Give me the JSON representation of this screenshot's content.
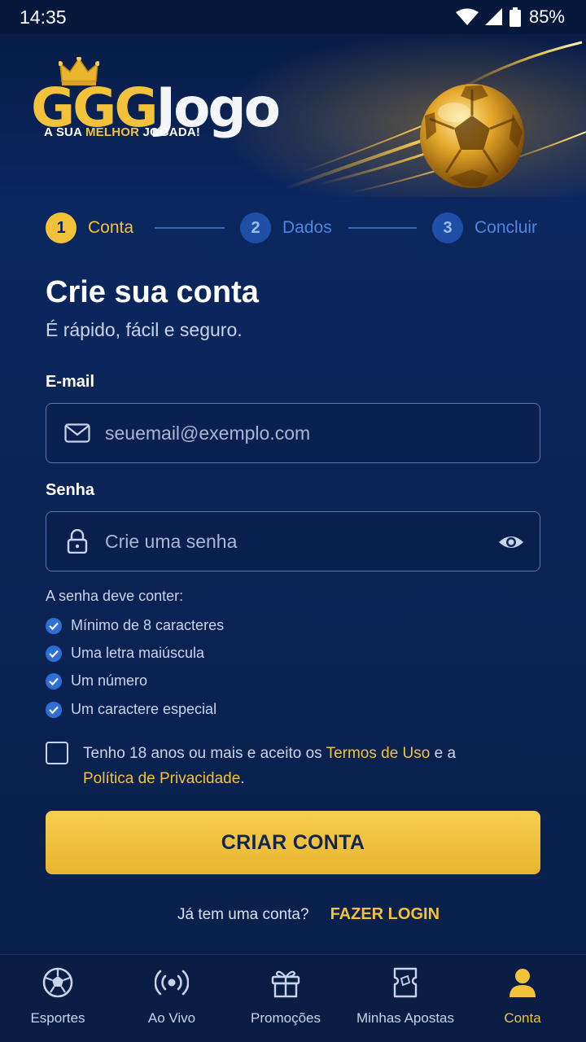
{
  "status_bar": {
    "time": "14:35",
    "battery": "85%"
  },
  "brand": {
    "logo_primary": "GGG",
    "logo_secondary": "Jogo",
    "tagline_start": "A SUA ",
    "tagline_highlight": "MELHOR",
    "tagline_end": " JOGADA!"
  },
  "stepper": [
    {
      "number": "1",
      "label": "Conta",
      "state": "active"
    },
    {
      "number": "2",
      "label": "Dados",
      "state": "inactive"
    },
    {
      "number": "3",
      "label": "Concluir",
      "state": "inactive"
    }
  ],
  "form": {
    "title": "Crie sua conta",
    "subtitle": "É rápido, fácil e seguro.",
    "email": {
      "label": "E-mail",
      "placeholder": "seuemail@exemplo.com",
      "value": "",
      "icon": "mail-icon"
    },
    "password": {
      "label": "Senha",
      "placeholder": "Crie uma senha",
      "value": "",
      "icon": "lock-icon",
      "toggle_icon": "eye-icon"
    },
    "rules_title": "A senha deve conter:",
    "rules": [
      "Mínimo de 8 caracteres",
      "Uma letra maiúscula",
      "Um número",
      "Um caractere especial"
    ],
    "terms": {
      "checked": false,
      "text_start": "Tenho 18 anos ou mais e aceito os ",
      "terms_link": "Termos de Uso",
      "text_middle": " e a ",
      "privacy_link": "Política de Privacidade",
      "text_end": "."
    },
    "submit_label": "CRIAR CONTA",
    "login_question": "Já tem uma conta?",
    "login_link": "FAZER LOGIN"
  },
  "bottom_nav": [
    {
      "label": "Esportes",
      "icon": "soccer-ball-icon",
      "active": false
    },
    {
      "label": "Ao Vivo",
      "icon": "live-broadcast-icon",
      "active": false
    },
    {
      "label": "Promoções",
      "icon": "gift-icon",
      "active": false
    },
    {
      "label": "Minhas Apostas",
      "icon": "bet-ticket-icon",
      "active": false
    },
    {
      "label": "Conta",
      "icon": "user-icon",
      "active": true
    }
  ],
  "colors": {
    "accent": "#f2c23a",
    "background": "#0b2456",
    "inactive_step": "#1f4fa6",
    "check": "#2d6fd6"
  }
}
